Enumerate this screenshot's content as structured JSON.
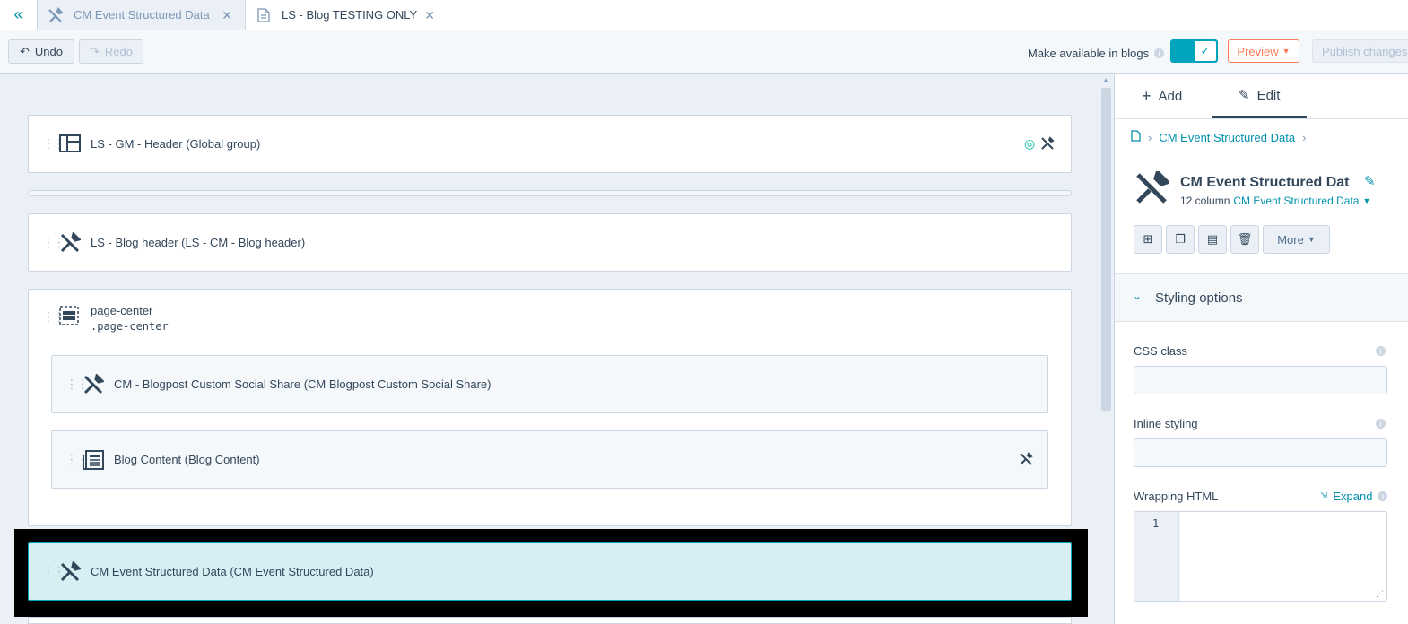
{
  "tabs": {
    "collapse_icon": "double-chevron-left-icon",
    "items": [
      {
        "label": "CM Event Structured Data",
        "icon": "tools-icon"
      },
      {
        "label": "LS - Blog TESTING ONLY",
        "icon": "page-icon"
      }
    ]
  },
  "toolbar": {
    "undo": "Undo",
    "redo": "Redo",
    "make_available": "Make available in blogs",
    "make_available_enabled": true,
    "preview": "Preview",
    "publish": "Publish changes"
  },
  "canvas": {
    "modules": [
      {
        "label": "LS - GM - Header (Global group)",
        "icon": "layout-icon"
      },
      {
        "label": "LS - Blog header (LS - CM - Blog header)",
        "icon": "tools-icon"
      },
      {
        "label": "page-center",
        "code": ".page-center",
        "icon": "section-icon"
      },
      {
        "label": "CM - Blogpost Custom Social Share (CM Blogpost Custom Social Share)",
        "icon": "tools-icon"
      },
      {
        "label": "Blog Content (Blog Content)",
        "icon": "blog-content-icon"
      },
      {
        "label": "CM Event Structured Data (CM Event Structured Data)",
        "icon": "tools-icon"
      }
    ]
  },
  "panel": {
    "tab_add": "Add",
    "tab_edit": "Edit",
    "breadcrumb": "CM Event Structured Data",
    "module_title": "CM Event Structured Dat",
    "columns": "12 column",
    "module_type": "CM Event Structured Data",
    "more": "More",
    "styling_options": "Styling options",
    "css_class_label": "CSS class",
    "css_class_value": "",
    "inline_styling_label": "Inline styling",
    "inline_styling_value": "",
    "wrapping_html_label": "Wrapping HTML",
    "expand": "Expand",
    "line_number": "1"
  },
  "colors": {
    "accent": "#00a4bd",
    "link": "#0091ae",
    "preview": "#ff7a59",
    "selected_bg": "#d7eff3"
  }
}
